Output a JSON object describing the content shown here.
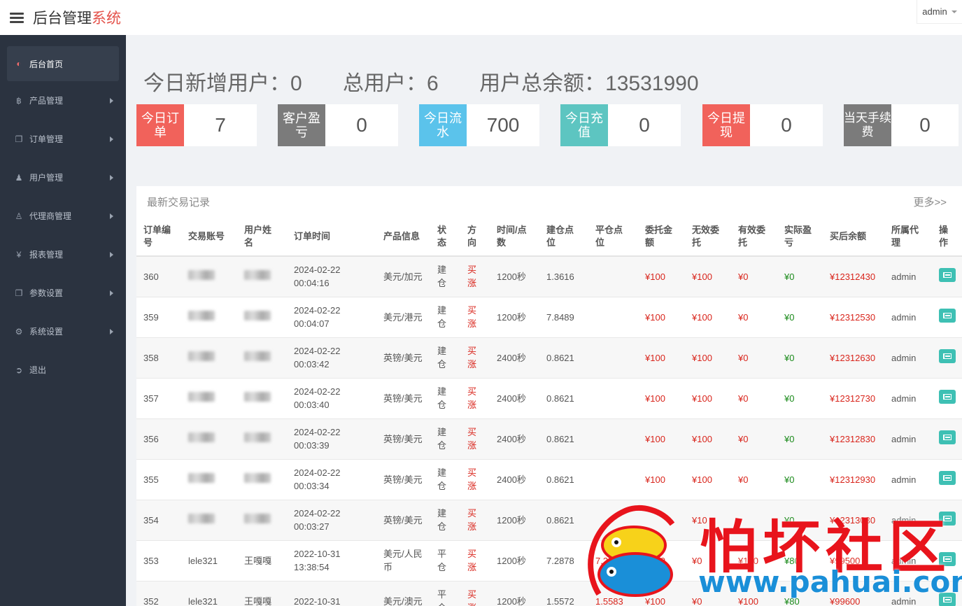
{
  "header": {
    "brand_main": "后台管理",
    "brand_accent": "系统",
    "user": "admin"
  },
  "sidebar": {
    "items": [
      {
        "label": "后台首页",
        "icon": "dashboard-icon",
        "active": true
      },
      {
        "label": "产品管理",
        "icon": "bitcoin-icon"
      },
      {
        "label": "订单管理",
        "icon": "copy-icon"
      },
      {
        "label": "用户管理",
        "icon": "user-icon"
      },
      {
        "label": "代理商管理",
        "icon": "users-icon"
      },
      {
        "label": "报表管理",
        "icon": "yen-icon"
      },
      {
        "label": "参数设置",
        "icon": "copy-icon"
      },
      {
        "label": "系统设置",
        "icon": "gears-icon"
      },
      {
        "label": "退出",
        "icon": "sign-out-icon"
      }
    ]
  },
  "stats": {
    "new_users_label": "今日新增用户：",
    "new_users": "0",
    "total_users_label": "总用户：",
    "total_users": "6",
    "balance_label": "用户总余额：",
    "balance": "13531990"
  },
  "cards": [
    {
      "label": "今日订单",
      "value": "7",
      "color": "#f1625b"
    },
    {
      "label": "客户盈亏",
      "value": "0",
      "color": "#7b7b7b"
    },
    {
      "label": "今日流水",
      "value": "700",
      "color": "#5bc3eb"
    },
    {
      "label": "今日充值",
      "value": "0",
      "color": "#5dc5c1"
    },
    {
      "label": "今日提现",
      "value": "0",
      "color": "#f1625b"
    },
    {
      "label": "当天手续费",
      "value": "0",
      "color": "#7b7b7b"
    }
  ],
  "table": {
    "title": "最新交易记录",
    "more": "更多>>",
    "headers": [
      "订单编号",
      "交易账号",
      "用户姓名",
      "订单时间",
      "产品信息",
      "状态",
      "方向",
      "时间/点数",
      "建仓点位",
      "平仓点位",
      "委托金额",
      "无效委托",
      "有效委托",
      "实际盈亏",
      "买后余额",
      "所属代理",
      "操作"
    ],
    "rows": [
      {
        "id": "360",
        "account": "",
        "name": "",
        "date": "2024-02-22",
        "time": "00:04:16",
        "product": "美元/加元",
        "status": "建仓",
        "direction": "买涨",
        "duration": "1200秒",
        "open": "1.3616",
        "close": "",
        "amount": "¥100",
        "invalid": "¥100",
        "valid": "¥0",
        "pnl": "¥0",
        "balance": "¥12312430",
        "agent": "admin"
      },
      {
        "id": "359",
        "account": "",
        "name": "",
        "date": "2024-02-22",
        "time": "00:04:07",
        "product": "美元/港元",
        "status": "建仓",
        "direction": "买涨",
        "duration": "1200秒",
        "open": "7.8489",
        "close": "",
        "amount": "¥100",
        "invalid": "¥100",
        "valid": "¥0",
        "pnl": "¥0",
        "balance": "¥12312530",
        "agent": "admin"
      },
      {
        "id": "358",
        "account": "",
        "name": "",
        "date": "2024-02-22",
        "time": "00:03:42",
        "product": "英镑/美元",
        "status": "建仓",
        "direction": "买涨",
        "duration": "2400秒",
        "open": "0.8621",
        "close": "",
        "amount": "¥100",
        "invalid": "¥100",
        "valid": "¥0",
        "pnl": "¥0",
        "balance": "¥12312630",
        "agent": "admin"
      },
      {
        "id": "357",
        "account": "",
        "name": "",
        "date": "2024-02-22",
        "time": "00:03:40",
        "product": "英镑/美元",
        "status": "建仓",
        "direction": "买涨",
        "duration": "2400秒",
        "open": "0.8621",
        "close": "",
        "amount": "¥100",
        "invalid": "¥100",
        "valid": "¥0",
        "pnl": "¥0",
        "balance": "¥12312730",
        "agent": "admin"
      },
      {
        "id": "356",
        "account": "",
        "name": "",
        "date": "2024-02-22",
        "time": "00:03:39",
        "product": "英镑/美元",
        "status": "建仓",
        "direction": "买涨",
        "duration": "2400秒",
        "open": "0.8621",
        "close": "",
        "amount": "¥100",
        "invalid": "¥100",
        "valid": "¥0",
        "pnl": "¥0",
        "balance": "¥12312830",
        "agent": "admin"
      },
      {
        "id": "355",
        "account": "",
        "name": "",
        "date": "2024-02-22",
        "time": "00:03:34",
        "product": "英镑/美元",
        "status": "建仓",
        "direction": "买涨",
        "duration": "2400秒",
        "open": "0.8621",
        "close": "",
        "amount": "¥100",
        "invalid": "¥100",
        "valid": "¥0",
        "pnl": "¥0",
        "balance": "¥12312930",
        "agent": "admin"
      },
      {
        "id": "354",
        "account": "",
        "name": "",
        "date": "2024-02-22",
        "time": "00:03:27",
        "product": "英镑/美元",
        "status": "建仓",
        "direction": "买涨",
        "duration": "1200秒",
        "open": "0.8621",
        "close": "",
        "amount": "",
        "invalid": "¥10",
        "valid": "",
        "pnl": "¥0",
        "balance": "¥12313030",
        "agent": "admin"
      },
      {
        "id": "353",
        "account": "lele321",
        "name": "王嘎嘎",
        "date": "2022-10-31",
        "time": "13:38:54",
        "product": "美元/人民币",
        "status": "平仓",
        "direction": "买涨",
        "duration": "1200秒",
        "open": "7.2878",
        "close": "7.2878",
        "amount": "¥100",
        "invalid": "¥0",
        "valid": "¥100",
        "pnl": "¥80",
        "balance": "¥99500",
        "agent": "admin"
      },
      {
        "id": "352",
        "account": "lele321",
        "name": "王嘎嘎",
        "date": "2022-10-31",
        "time": "",
        "product": "美元/澳元",
        "status": "平仓",
        "direction": "买涨",
        "duration": "1200秒",
        "open": "1.5572",
        "close": "1.5583",
        "amount": "¥100",
        "invalid": "¥0",
        "valid": "¥100",
        "pnl": "¥80",
        "balance": "¥99600",
        "agent": "admin"
      }
    ]
  },
  "watermark": {
    "cn": "怕坏社区",
    "url": "www.pahuai.com"
  }
}
